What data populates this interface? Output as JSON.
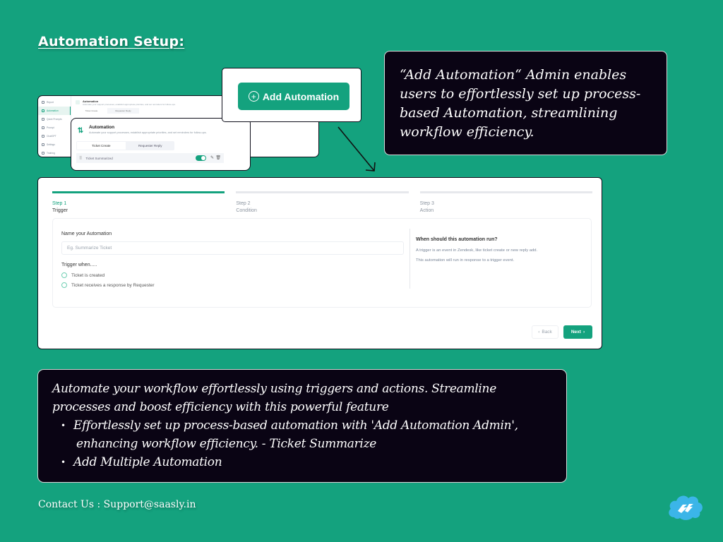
{
  "page": {
    "title": "Automation Setup:",
    "contact": "Contact Us : Support@saasly.in",
    "logo_icon": "saasly-cloud-logo-icon"
  },
  "colors": {
    "background": "#14a27e",
    "accent": "#14a27e",
    "callout_bg": "#0a0414",
    "logo_blue": "#3bb5e8"
  },
  "mini_app": {
    "sidebar": [
      {
        "label": "Report",
        "icon": "report-icon"
      },
      {
        "label": "Automation",
        "icon": "automation-icon",
        "active": true
      },
      {
        "label": "Quick Prompts",
        "icon": "quick-prompts-icon"
      },
      {
        "label": "Prompt",
        "icon": "prompt-icon"
      },
      {
        "label": "ChatGPT",
        "icon": "chatgpt-icon"
      },
      {
        "label": "Settings",
        "icon": "settings-icon"
      },
      {
        "label": "Training",
        "icon": "training-icon"
      }
    ],
    "header_title": "Automation",
    "header_subtitle": "Automate your support processes, establish appropriate priorities, and set reminders for follow-ups.",
    "tabs": [
      "Ticket Create",
      "Requester Reply"
    ],
    "active_tab": "Ticket Create",
    "automation_item": {
      "label": "Ticket Summarized",
      "enabled": true
    }
  },
  "add_popover": {
    "button_label": "Add Automation"
  },
  "callout_text": "“Add Automation“ Admin enables users to effortlessly set up process-based Automation, streamlining workflow efficiency.",
  "wizard": {
    "steps": [
      {
        "num": "Step 1",
        "name": "Trigger",
        "active": true
      },
      {
        "num": "Step 2",
        "name": "Condition",
        "active": false
      },
      {
        "num": "Step 3",
        "name": "Action",
        "active": false
      }
    ],
    "name_label": "Name your Automation",
    "name_placeholder": "Eg. Summarize Ticket",
    "name_value": "",
    "trigger_label": "Trigger when.....",
    "trigger_options": [
      "Ticket is created",
      "Ticket receives a response by Requester"
    ],
    "info_title": "When should this automation run?",
    "info_line1": "A trigger is an event in Zendesk, like ticket create or new reply add.",
    "info_line2": "This automation will run in response to a trigger event.",
    "back_label": "Back",
    "next_label": "Next"
  },
  "description": {
    "intro": "Automate your workflow effortlessly using triggers and actions. Streamline processes and boost efficiency with this powerful feature",
    "bullets": [
      {
        "line1": "Effortlessly set up process-based automation with 'Add Automation Admin',",
        "line2": "enhancing workflow efficiency. - Ticket Summarize"
      },
      {
        "line1": "Add Multiple Automation",
        "line2": ""
      }
    ]
  }
}
